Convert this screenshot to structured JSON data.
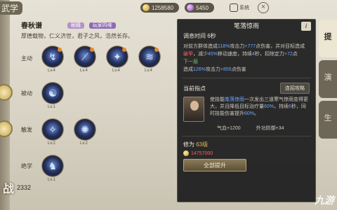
{
  "header": {
    "title_fragment": "武学",
    "currency_gold": "1258580",
    "currency_gem": "5450",
    "system_label": "系统"
  },
  "book": {
    "title": "春秋谱",
    "tags": [
      "秘籍",
      "玩家四维"
    ],
    "description": "厚德载物，仁义济世，君子之风，浩然长存。"
  },
  "categories": {
    "active": "主动",
    "passive": "被动",
    "trigger": "触发",
    "ultimate": "绝学"
  },
  "skill_levels": [
    "Lv.4",
    "Lv.4",
    "Lv.4",
    "Lv.4",
    "Lv.1",
    "Lv.2",
    "Lv.2",
    "Lv.1"
  ],
  "power": {
    "char": "战",
    "value": "2332"
  },
  "panel": {
    "title": "笔落惊雨",
    "info": "i",
    "cooldown": "调息时间 6秒",
    "desc_parts": [
      "对前方群体造成",
      "118%",
      "攻击力",
      "+777",
      "点伤害，并对目标造成",
      "破甲",
      "，减少",
      "45%",
      "移动速度，持续",
      "4",
      "秒，扣除定力",
      "+72",
      "点"
    ],
    "next_label": "下一层",
    "next_desc_parts": [
      "造成",
      "126%",
      "攻击力",
      "+855",
      "点伤害"
    ],
    "guide_header": "当前指点",
    "guide_button": "连招攻略",
    "guide_text_parts": [
      "使技能",
      "笔落惊雨",
      "一次发出三道寒气惊雨变得更大，并且降低目标治疗量",
      "60%",
      "，持续",
      "6",
      "秒，同时技能伤害提升",
      "60%",
      "。"
    ],
    "stat_hp": "气血+1200",
    "stat_def": "外功防御+34",
    "cultivation_label": "修为",
    "cultivation_value": "63级",
    "cost": "14757000",
    "upgrade_button": "全部提升"
  },
  "right_tabs": [
    "提",
    "演",
    "生"
  ],
  "watermark": "九游"
}
